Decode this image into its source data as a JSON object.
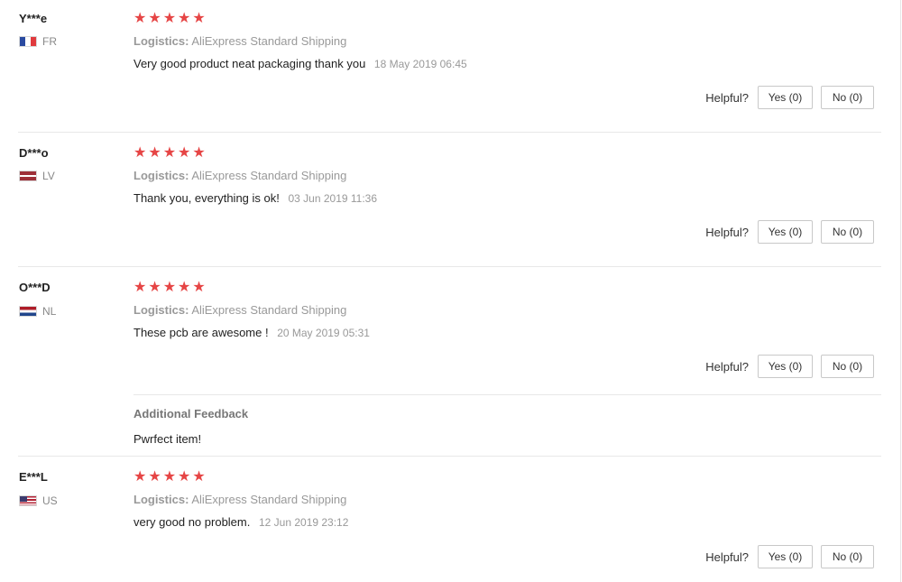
{
  "reviews": [
    {
      "user": "Y***e",
      "country": "FR",
      "flag": "flag-fr",
      "stars": "★★★★★",
      "rating": 5,
      "logistics_label": "Logistics:",
      "logistics_value": "AliExpress Standard Shipping",
      "text": "Very good product neat packaging thank you",
      "date": "18 May 2019 06:45",
      "helpful_label": "Helpful?",
      "yes_label": "Yes (0)",
      "no_label": "No (0)"
    },
    {
      "user": "D***o",
      "country": "LV",
      "flag": "flag-lv",
      "stars": "★★★★★",
      "rating": 5,
      "logistics_label": "Logistics:",
      "logistics_value": "AliExpress Standard Shipping",
      "text": "Thank you, everything is ok!",
      "date": "03 Jun 2019 11:36",
      "helpful_label": "Helpful?",
      "yes_label": "Yes (0)",
      "no_label": "No (0)"
    },
    {
      "user": "O***D",
      "country": "NL",
      "flag": "flag-nl",
      "stars": "★★★★★",
      "rating": 5,
      "logistics_label": "Logistics:",
      "logistics_value": "AliExpress Standard Shipping",
      "text": "These pcb are awesome !",
      "date": "20 May 2019 05:31",
      "helpful_label": "Helpful?",
      "yes_label": "Yes (0)",
      "no_label": "No (0)",
      "additional_title": "Additional Feedback",
      "additional_text": "Pwrfect item!"
    },
    {
      "user": "E***L",
      "country": "US",
      "flag": "flag-us",
      "stars": "★★★★★",
      "rating": 5,
      "logistics_label": "Logistics:",
      "logistics_value": "AliExpress Standard Shipping",
      "text": "very good no problem.",
      "date": "12 Jun 2019 23:12",
      "helpful_label": "Helpful?",
      "yes_label": "Yes (0)",
      "no_label": "No (0)"
    }
  ],
  "colors": {
    "star": "#e64545",
    "muted": "#999999",
    "divider": "#e8e8e8"
  }
}
